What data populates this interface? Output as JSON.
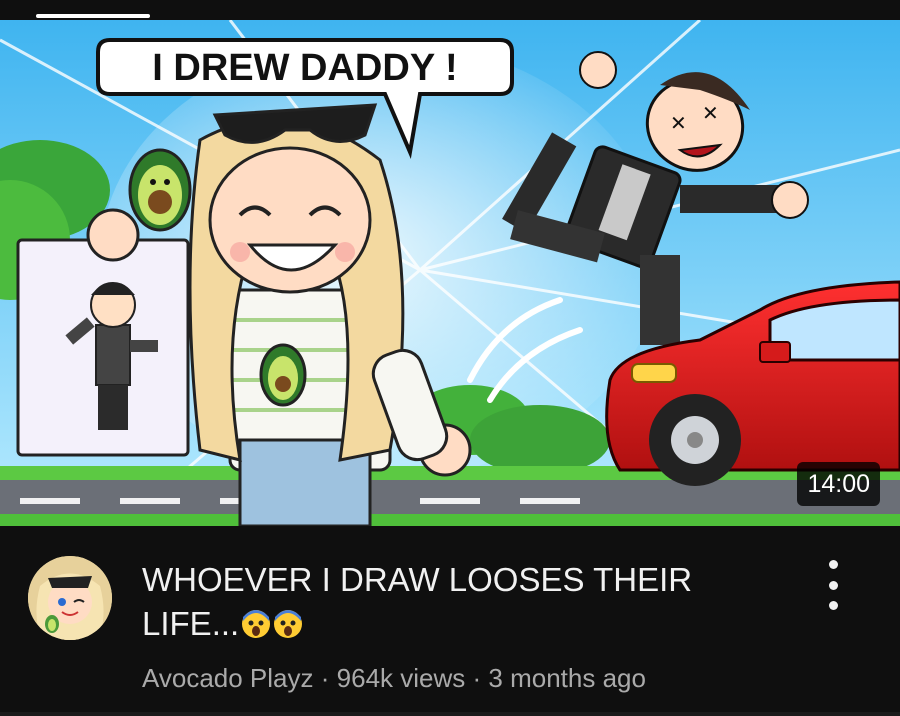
{
  "video": {
    "duration": "14:00",
    "thumbnail_caption": "I DREW DADDY !",
    "title_text": "WHOEVER I DRAW LOOSES THEIR LIFE...",
    "title_emojis": [
      "fearful-face-emoji",
      "fearful-face-emoji"
    ]
  },
  "channel": {
    "name": "Avocado Playz",
    "separator": "·",
    "views": "964k views",
    "age": "3 months ago"
  },
  "icons": [
    "more-options-icon",
    "channel-avatar"
  ],
  "colors": {
    "background": "#0f0f0f",
    "title_text": "#f1f1f1",
    "secondary_text": "#aaaaaa",
    "car_red": "#d51b1b",
    "sky": "#4fc3f7"
  }
}
